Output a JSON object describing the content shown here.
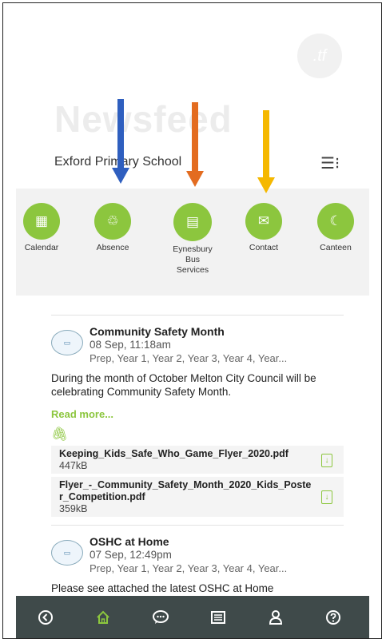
{
  "header": {
    "logo_text": ".tf",
    "watermark": "Newsfeed",
    "school_name": "Exford Primary School",
    "menu_icon": "menu-icon"
  },
  "quick_links": [
    {
      "label": "Calendar",
      "icon": "calendar-icon"
    },
    {
      "label": "Absence",
      "icon": "absence-icon"
    },
    {
      "label": "Eynesbury Bus Services",
      "icon": "document-icon"
    },
    {
      "label": "Contact",
      "icon": "mail-icon"
    },
    {
      "label": "Canteen",
      "icon": "canteen-icon"
    }
  ],
  "annotation_arrows": [
    {
      "color": "#2f5fbf"
    },
    {
      "color": "#e36c20"
    },
    {
      "color": "#f5b800"
    }
  ],
  "posts": [
    {
      "title": "Community Safety Month",
      "date": "08 Sep, 11:18am",
      "tags": "Prep, Year 1, Year 2, Year 3, Year 4, Year...",
      "body": "During the month of October Melton City Council will be celebrating Community Safety Month.",
      "read_more": "Read more...",
      "attachments": [
        {
          "name": "Keeping_Kids_Safe_Who_Game_Flyer_2020.pdf",
          "size": "447kB"
        },
        {
          "name": "Flyer_-_Community_Safety_Month_2020_Kids_Poster_Competition.pdf",
          "size": "359kB"
        }
      ]
    },
    {
      "title": "OSHC at Home",
      "date": "07 Sep, 12:49pm",
      "tags": "Prep, Year 1, Year 2, Year 3, Year 4, Year...",
      "body": "Please see attached the latest OSHC at Home"
    }
  ],
  "bottom_nav": [
    {
      "icon": "back-icon",
      "glyph": "◁"
    },
    {
      "icon": "home-icon",
      "glyph": "⌂"
    },
    {
      "icon": "chat-icon",
      "glyph": "💬"
    },
    {
      "icon": "list-icon",
      "glyph": "☰"
    },
    {
      "icon": "profile-icon",
      "glyph": "👤"
    },
    {
      "icon": "help-icon",
      "glyph": "?"
    }
  ],
  "colors": {
    "accent": "#8cc63e",
    "nav_bg": "#3f4a4a"
  }
}
